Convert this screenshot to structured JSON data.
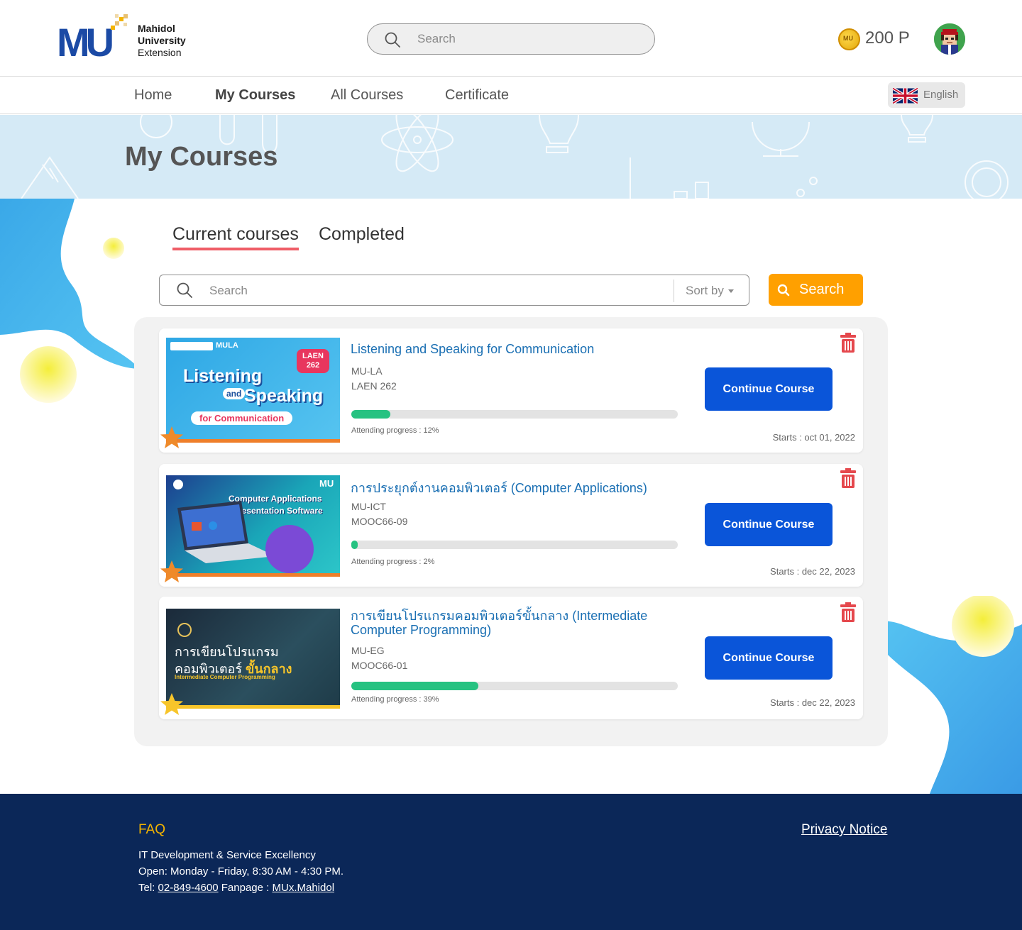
{
  "header": {
    "logo_lines": [
      "Mahidol",
      "University",
      "Extension"
    ],
    "search_placeholder": "Search",
    "points": "200 P",
    "coin_label": "MU"
  },
  "nav": {
    "items": [
      {
        "label": "Home"
      },
      {
        "label": "My Courses",
        "active": true
      },
      {
        "label": "All Courses"
      },
      {
        "label": "Certificate"
      }
    ],
    "language": "English"
  },
  "banner": {
    "title": "My Courses"
  },
  "tabs": [
    {
      "label": "Current courses",
      "active": true
    },
    {
      "label": "Completed"
    }
  ],
  "list_search": {
    "placeholder": "Search",
    "sort_label": "Sort by",
    "button_label": "Search"
  },
  "courses": [
    {
      "title": "Listening and Speaking for Communication",
      "org": "MU-LA",
      "code": "LAEN 262",
      "progress": 12,
      "progress_label": "Attending progress : 12%",
      "button": "Continue Course",
      "starts": "Starts : oct 01, 2022",
      "thumb": {
        "tag": "MULA",
        "badge_line1": "LAEN",
        "badge_line2": "262",
        "line1": "Listening",
        "line2": "and",
        "line3": "Speaking",
        "line4": "for Communication"
      }
    },
    {
      "title": "การประยุกต์งานคอมพิวเตอร์ (Computer Applications)",
      "org": "MU-ICT",
      "code": "MOOC66-09",
      "progress": 2,
      "progress_label": "Attending progress : 2%",
      "button": "Continue Course",
      "starts": "Starts : dec 22, 2023",
      "thumb": {
        "tag": "MU",
        "line1": "Computer Applications",
        "line2": "Presentation Software"
      }
    },
    {
      "title": "การเขียนโปรแกรมคอมพิวเตอร์ขั้นกลาง (Intermediate Computer Programming)",
      "org": "MU-EG",
      "code": "MOOC66-01",
      "progress": 39,
      "progress_label": "Attending progress : 39%",
      "button": "Continue Course",
      "starts": "Starts : dec 22, 2023",
      "thumb": {
        "line1": "การเขียนโปรแกรม",
        "line2a": "คอมพิวเตอร์",
        "line2b": "ขั้นกลาง",
        "line3": "Intermediate Computer Programming"
      }
    }
  ],
  "footer": {
    "faq": "FAQ",
    "line1": "IT Development & Service Excellency",
    "line2": "Open: Monday - Friday, 8:30 AM - 4:30 PM.",
    "tel_label": "Tel:",
    "tel": "02-849-4600",
    "fanpage_label": "Fanpage :",
    "fanpage": "MUx.Mahidol",
    "privacy": "Privacy Notice"
  },
  "colors": {
    "brand_blue": "#1b4aa5",
    "button_blue": "#0a55d9",
    "search_orange": "#ffa000",
    "progress_green": "#26c281",
    "tab_underline": "#ef5d67",
    "footer_navy": "#0b2758",
    "faq_gold": "#f4b400",
    "trash_red": "#e5484d"
  }
}
